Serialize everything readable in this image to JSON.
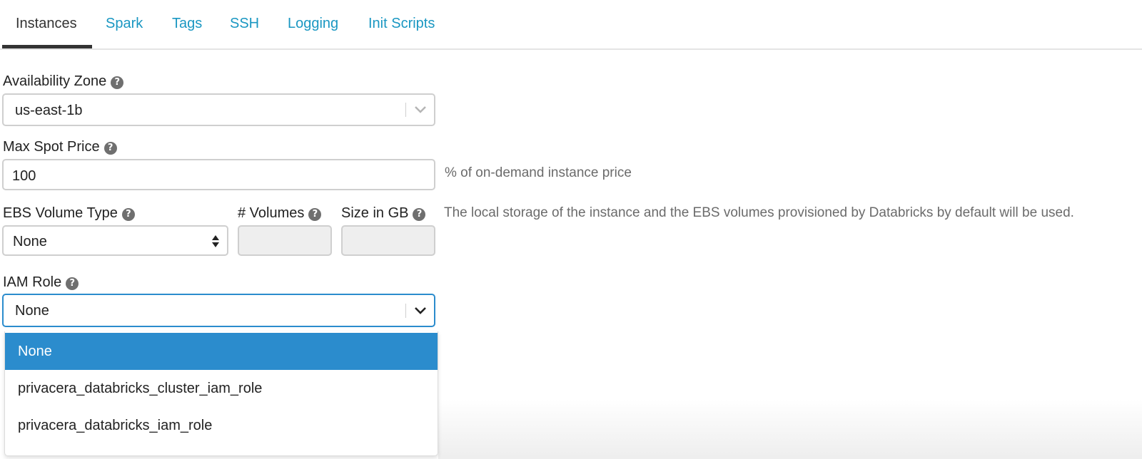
{
  "tabs": [
    {
      "label": "Instances",
      "active": true
    },
    {
      "label": "Spark",
      "active": false
    },
    {
      "label": "Tags",
      "active": false
    },
    {
      "label": "SSH",
      "active": false
    },
    {
      "label": "Logging",
      "active": false
    },
    {
      "label": "Init Scripts",
      "active": false
    }
  ],
  "availability_zone": {
    "label": "Availability Zone",
    "value": "us-east-1b"
  },
  "max_spot_price": {
    "label": "Max Spot Price",
    "value": "100",
    "suffix": "% of on-demand instance price"
  },
  "ebs": {
    "volume_type_label": "EBS Volume Type",
    "volume_type_value": "None",
    "volumes_label": "# Volumes",
    "volumes_value": "",
    "size_label": "Size in GB",
    "size_value": "",
    "note": "The local storage of the instance and the EBS volumes provisioned by Databricks by default will be used."
  },
  "iam_role": {
    "label": "IAM Role",
    "value": "None",
    "options": [
      {
        "label": "None",
        "selected": true
      },
      {
        "label": "privacera_databricks_cluster_iam_role",
        "selected": false
      },
      {
        "label": "privacera_databricks_iam_role",
        "selected": false
      }
    ]
  },
  "icons": {
    "help": "question-circle-icon",
    "dropdown": "chevron-down-icon",
    "stepper": "sort-arrows-icon"
  },
  "colors": {
    "link": "#1a97c2",
    "accent": "#2b8ccd",
    "muted": "#6b6b6b"
  }
}
